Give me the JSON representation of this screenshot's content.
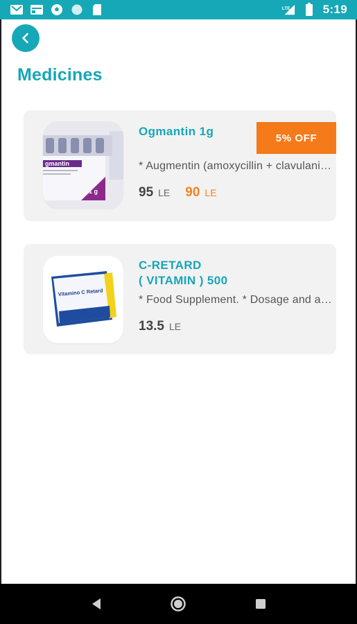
{
  "status_bar": {
    "time": "5:19",
    "left_icons": [
      "gmail-icon",
      "calendar-icon",
      "soccer-icon",
      "circle-icon",
      "sd-card-icon"
    ],
    "right_icons": [
      "lte-signal-icon",
      "battery-icon"
    ],
    "network_label": "LTE"
  },
  "header": {
    "title": "Medicines",
    "back_icon": "chevron-left-icon"
  },
  "products": [
    {
      "name": "Ogmantin 1g",
      "description": "* Augmentin (amoxycillin + clavulanic acid)",
      "price": "95",
      "price_unit": "LE",
      "sale_price": "90",
      "sale_price_unit": "LE",
      "discount_label": "5% OFF",
      "box_label": "gmantin",
      "box_dose": "1 g"
    },
    {
      "name": "C-RETARD\n( VITAMIN ) 500",
      "name_line1": "C-RETARD",
      "name_line2": "( VITAMIN ) 500",
      "description": "* Food Supplement. * Dosage and administration",
      "price": "13.5",
      "price_unit": "LE",
      "box_label": "Vitamino C Retard"
    }
  ],
  "colors": {
    "accent": "#16a8b6",
    "discount": "#f57a1a",
    "card_bg": "#f2f2f2"
  },
  "nav_bar": {
    "icons": [
      "back-triangle-icon",
      "home-circle-icon",
      "recents-square-icon"
    ]
  }
}
